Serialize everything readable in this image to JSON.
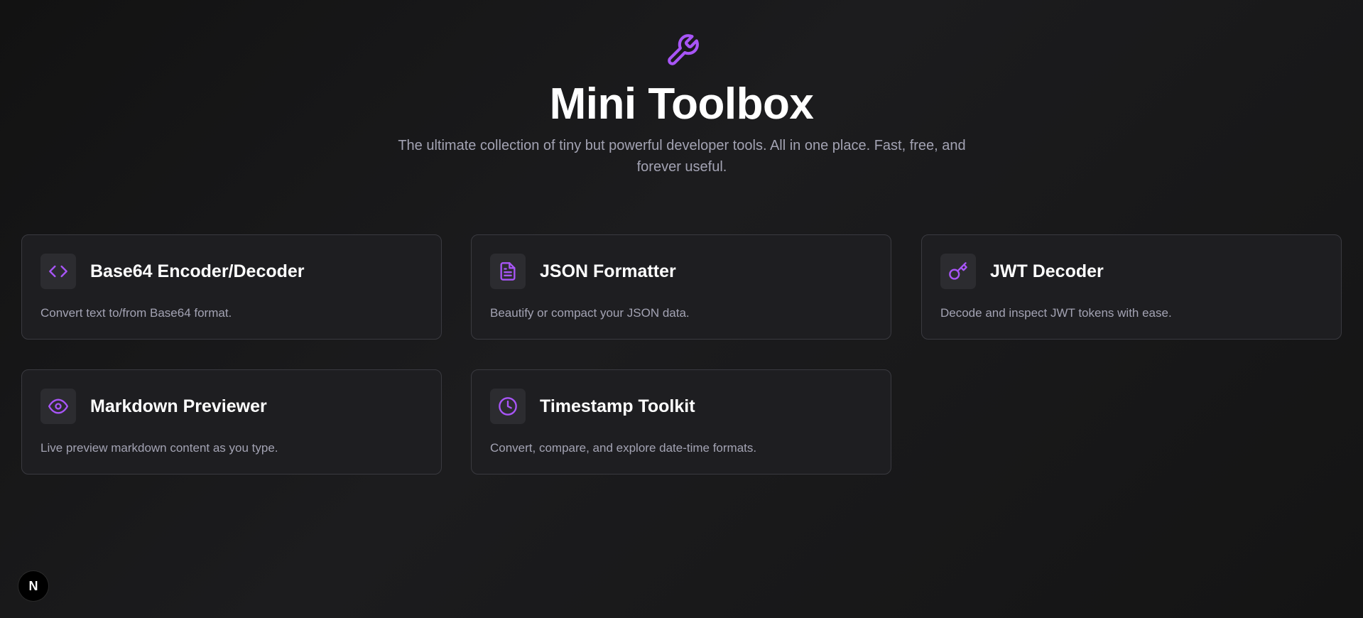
{
  "colors": {
    "accent": "#a855f7",
    "background": "#1a1a1c",
    "card_background": "#1e1e21",
    "card_border": "#3a3a40",
    "text_muted": "#a3a3b3"
  },
  "hero": {
    "icon": "wrench-icon",
    "title": "Mini Toolbox",
    "subtitle": "The ultimate collection of tiny but powerful developer tools. All in one place. Fast, free, and forever useful."
  },
  "tools": [
    {
      "icon": "code-brackets-icon",
      "title": "Base64 Encoder/Decoder",
      "description": "Convert text to/from Base64 format."
    },
    {
      "icon": "file-text-icon",
      "title": "JSON Formatter",
      "description": "Beautify or compact your JSON data."
    },
    {
      "icon": "key-icon",
      "title": "JWT Decoder",
      "description": "Decode and inspect JWT tokens with ease."
    },
    {
      "icon": "eye-icon",
      "title": "Markdown Previewer",
      "description": "Live preview markdown content as you type."
    },
    {
      "icon": "clock-icon",
      "title": "Timestamp Toolkit",
      "description": "Convert, compare, and explore date-time formats."
    }
  ],
  "dev_badge": {
    "icon": "nextjs-logo-icon",
    "label": "N"
  }
}
